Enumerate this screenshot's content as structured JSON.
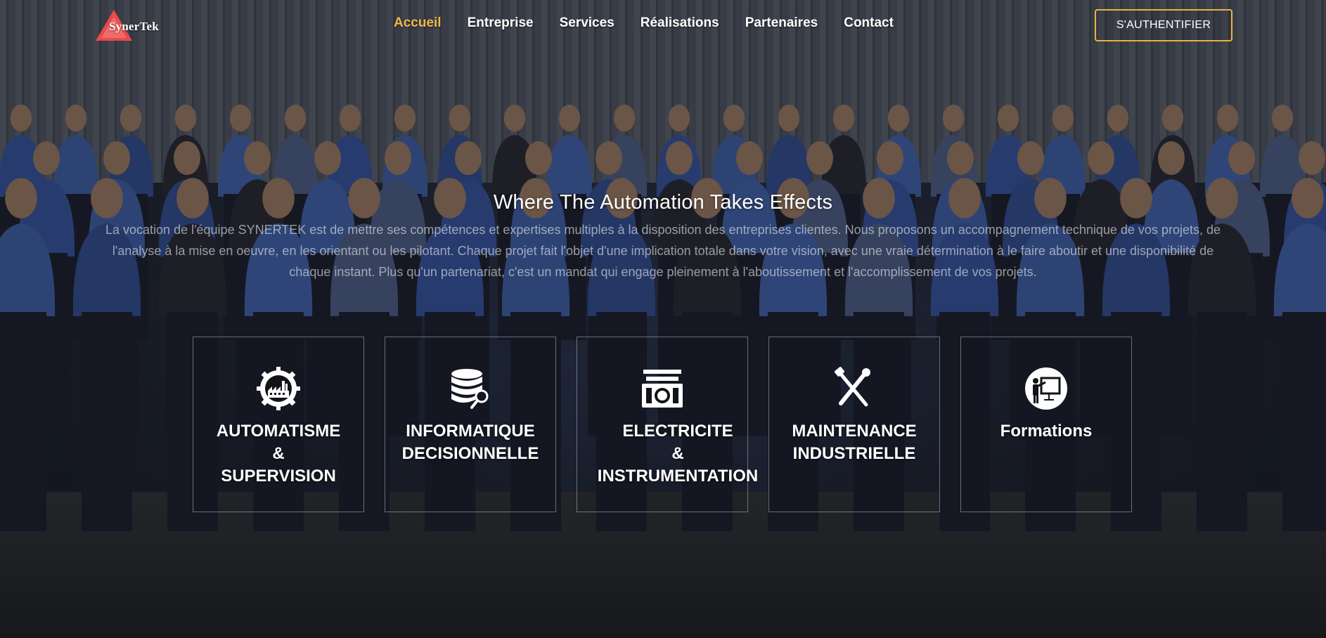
{
  "brand": {
    "logo_text": "SynerTek",
    "accent_color": "#f2b84b",
    "logo_color": "#e84a4a"
  },
  "nav": {
    "items": [
      {
        "label": "Accueil",
        "active": true
      },
      {
        "label": "Entreprise",
        "active": false
      },
      {
        "label": "Services",
        "active": false
      },
      {
        "label": "Réalisations",
        "active": false
      },
      {
        "label": "Partenaires",
        "active": false
      },
      {
        "label": "Contact",
        "active": false
      }
    ],
    "auth_label": "S'AUTHENTIFIER"
  },
  "hero": {
    "title": "Where The Automation Takes Effects",
    "description": "La vocation de l'équipe SYNERTEK est de mettre ses compétences et expertises multiples à la disposition des entreprises clientes. Nous proposons un accompagnement technique de vos projets, de l'analyse à la mise en oeuvre, en les orientant ou les pilotant. Chaque projet fait l'objet d'une implication totale dans votre vision, avec une vraie détermination à le faire aboutir et une disponibilité de chaque instant. Plus qu'un partenariat, c'est un mandat qui engage pleinement à l'aboutissement et l'accomplissement de vos projets."
  },
  "services": [
    {
      "label": "AUTOMATISME\n&\nSUPERVISION",
      "icon": "factory-gear-icon"
    },
    {
      "label": "INFORMATIQUE\nDECISIONNELLE",
      "icon": "database-icon"
    },
    {
      "label": "ELECTRICITE\n&\nINSTRUMENTATION",
      "icon": "meter-icon"
    },
    {
      "label": "MAINTENANCE\nINDUSTRIELLE",
      "icon": "tools-icon"
    },
    {
      "label": "Formations",
      "icon": "presentation-icon"
    }
  ]
}
